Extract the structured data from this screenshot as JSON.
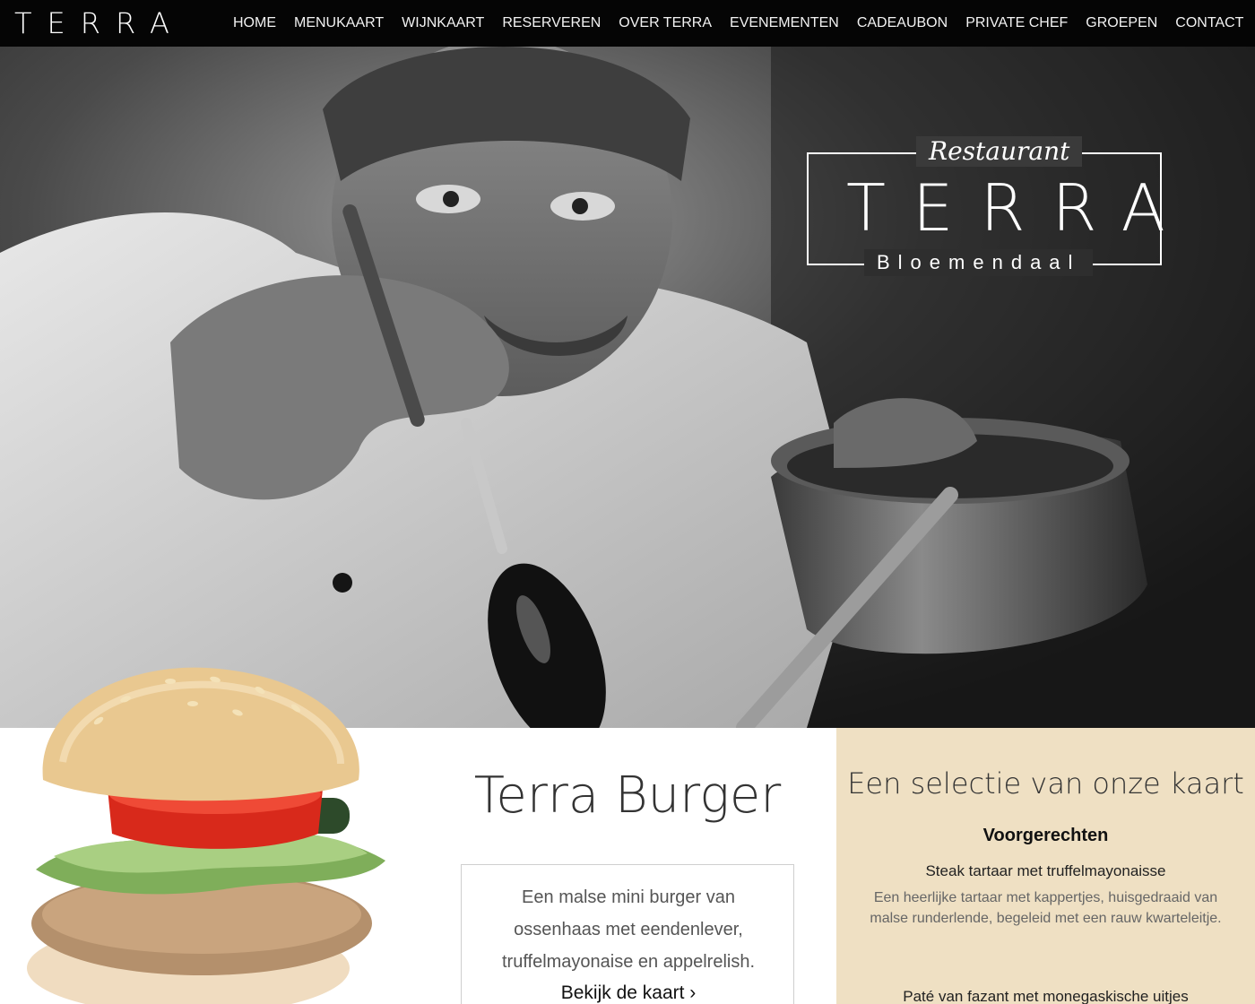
{
  "header": {
    "brand": "TERRA",
    "nav": [
      "HOME",
      "MENUKAART",
      "WIJNKAART",
      "RESERVEREN",
      "OVER TERRA",
      "EVENEMENTEN",
      "CADEAUBON",
      "PRIVATE CHEF",
      "GROEPEN",
      "CONTACT"
    ]
  },
  "hero": {
    "logo_script": "Restaurant",
    "logo_main": "TERRA",
    "logo_sub": "Bloemendaal"
  },
  "feature": {
    "title": "Terra Burger",
    "description": "Een malse mini burger van ossenhaas met eendenlever, truffelmayonaise en appelrelish.",
    "link": "Bekijk de kaart ›"
  },
  "menu_panel": {
    "title": "Een selectie van onze kaart",
    "category": "Voorgerechten",
    "items": [
      {
        "name": "Steak tartaar met truffelmayonaisse",
        "description": "Een heerlijke tartaar met kappertjes, huisgedraaid van malse runderlende, begeleid met een rauw kwarteleitje."
      },
      {
        "name": "Paté van fazant met monegaskische uitjes"
      }
    ]
  },
  "colors": {
    "nav_bg": "#050505",
    "panel_bg": "#efe0c3"
  }
}
